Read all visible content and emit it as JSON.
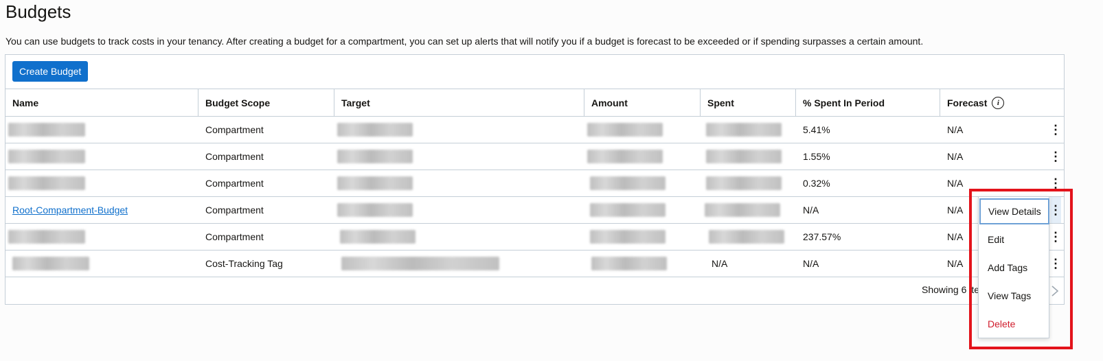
{
  "page": {
    "title": "Budgets",
    "description": "You can use budgets to track costs in your tenancy. After creating a budget for a compartment, you can set up alerts that will notify you if a budget is forecast to be exceeded or if spending surpasses a certain amount."
  },
  "toolbar": {
    "create_label": "Create Budget"
  },
  "table": {
    "columns": {
      "name": "Name",
      "scope": "Budget Scope",
      "target": "Target",
      "amount": "Amount",
      "spent": "Spent",
      "pct": "% Spent In Period",
      "forecast": "Forecast"
    },
    "info_icon_glyph": "i",
    "rows": [
      {
        "name": "",
        "scope": "Compartment",
        "target": "",
        "amount": "",
        "spent": "",
        "pct": "5.41%",
        "forecast": "N/A"
      },
      {
        "name": "",
        "scope": "Compartment",
        "target": "",
        "amount": "",
        "spent": "",
        "pct": "1.55%",
        "forecast": "N/A"
      },
      {
        "name": "",
        "scope": "Compartment",
        "target": "",
        "amount": "",
        "spent": "",
        "pct": "0.32%",
        "forecast": "N/A"
      },
      {
        "name": "Root-Compartment-Budget",
        "scope": "Compartment",
        "target": "",
        "amount": "",
        "spent": "",
        "pct": "N/A",
        "forecast": "N/A"
      },
      {
        "name": "",
        "scope": "Compartment",
        "target": "",
        "amount": "",
        "spent": "",
        "pct": "237.57%",
        "forecast": "N/A"
      },
      {
        "name": "",
        "scope": "Cost-Tracking Tag",
        "target": "",
        "amount": "",
        "spent": "N/A",
        "pct": "N/A",
        "forecast": "N/A"
      }
    ],
    "kebab_glyph": "⋮",
    "footer": "Showing 6 ite"
  },
  "row_menu": {
    "items": [
      "View Details",
      "Edit",
      "Add Tags",
      "View Tags",
      "Delete"
    ]
  },
  "colors": {
    "primary": "#1070cc",
    "danger": "#d01c2c",
    "annotation": "#e3131b",
    "border": "#c4ced7"
  },
  "icons": {
    "info": "info-icon",
    "row_actions": "kebab-icon",
    "next_page": "chevron-right-icon"
  }
}
